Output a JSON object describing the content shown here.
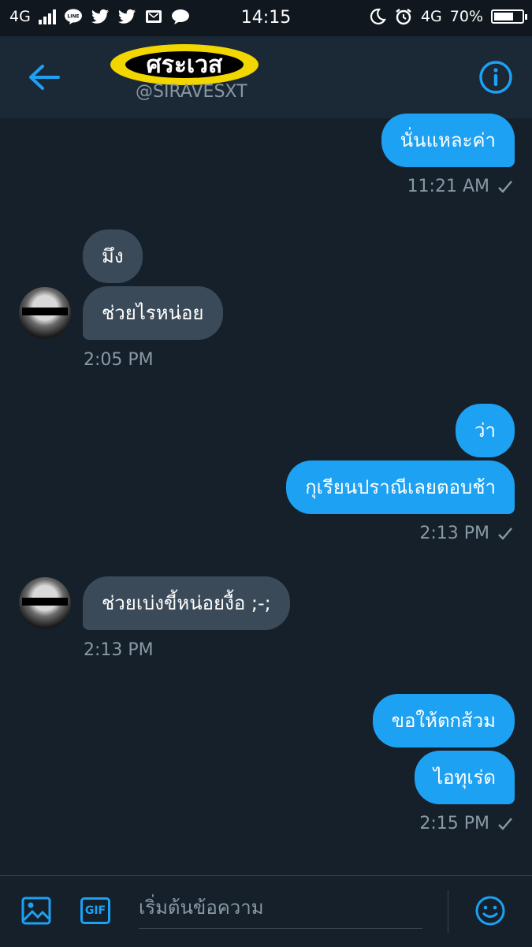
{
  "status_bar": {
    "network_left": "4G",
    "time": "14:15",
    "network_right": "4G",
    "battery": "70%",
    "battery_level": 0.7,
    "icons": [
      "signal-icon",
      "line-app-icon",
      "twitter-icon",
      "twitter-icon",
      "mail-icon",
      "chat-bubble-icon",
      "moon-icon",
      "alarm-icon",
      "battery-icon"
    ]
  },
  "header": {
    "name": "ศระเวส",
    "handle": "@SIRAVESXT",
    "highlight_color": "#f2d600"
  },
  "messages": {
    "m1": {
      "text": "นั่นแหละค่า",
      "time": "11:21 AM"
    },
    "m2": {
      "text": "มึง"
    },
    "m3": {
      "text": "ช่วยไรหน่อย",
      "time": "2:05 PM"
    },
    "m4": {
      "text": "ว่า"
    },
    "m5": {
      "text": "กุเรียนปราณีเลยตอบช้า",
      "time": "2:13 PM"
    },
    "m6": {
      "text": "ช่วยเบ่งขี้หน่อยงื้อ ;-;",
      "time": "2:13 PM"
    },
    "m7": {
      "text": "ขอให้ตกส้วม"
    },
    "m8": {
      "text": "ไอทุเร่ด",
      "time": "2:15 PM"
    }
  },
  "composer": {
    "placeholder": "เริ่มต้นข้อความ",
    "gif_label": "GIF"
  },
  "colors": {
    "background": "#15202b",
    "header": "#1b2836",
    "outgoing_bubble": "#1da1f2",
    "incoming_bubble": "#3a4a59",
    "accent": "#1da1f2"
  }
}
